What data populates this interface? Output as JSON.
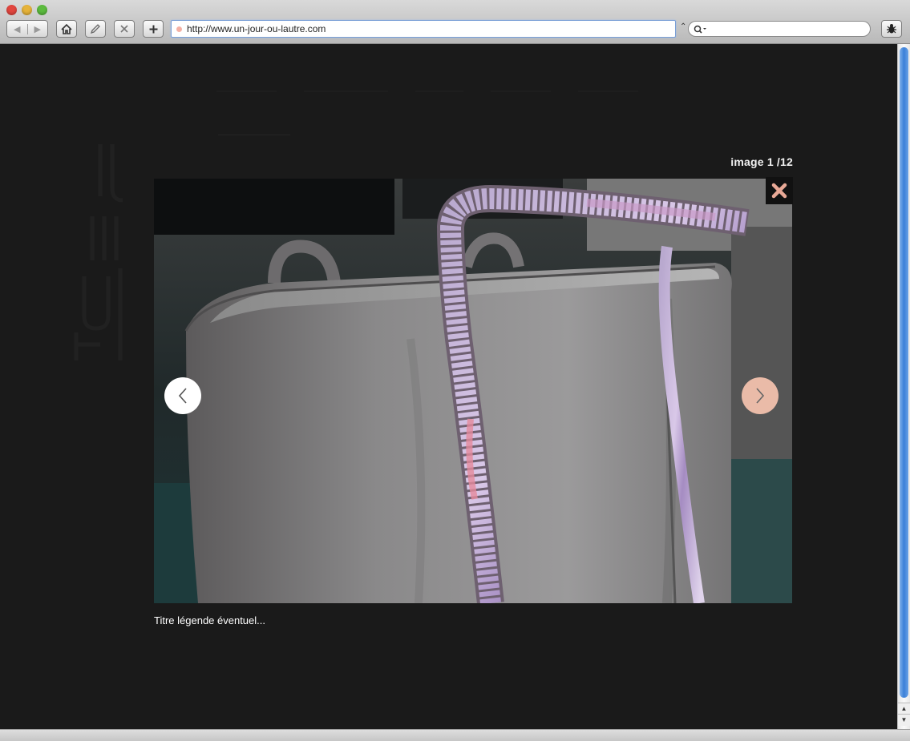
{
  "browser": {
    "url": "http://www.un-jour-ou-lautre.com",
    "search_placeholder": ""
  },
  "lightbox": {
    "counter": "image 1 /12",
    "caption": "Titre légende éventuel..."
  },
  "colors": {
    "page_background": "#1a1a1a",
    "next_button": "#eabba8",
    "close_icon": "#e8a896",
    "url_favicon": "#f4b0a4"
  },
  "icons": {
    "close": "close-icon",
    "prev": "chevron-left-icon",
    "next": "chevron-right-icon",
    "search": "search-icon",
    "home": "home-icon",
    "bug": "bug-icon"
  }
}
